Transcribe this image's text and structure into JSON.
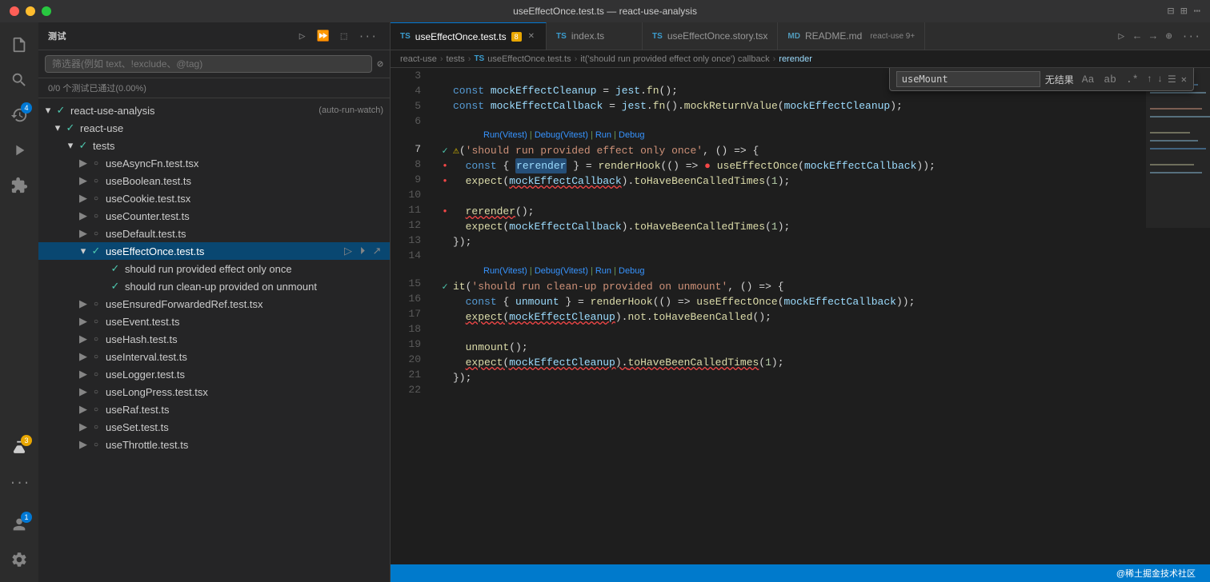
{
  "titleBar": {
    "title": "useEffectOnce.test.ts — react-use-analysis"
  },
  "activityBar": {
    "icons": [
      {
        "name": "files-icon",
        "symbol": "⎘",
        "active": false
      },
      {
        "name": "search-icon",
        "symbol": "🔍",
        "active": false
      },
      {
        "name": "source-control-icon",
        "symbol": "⑂",
        "active": false,
        "badge": "4",
        "badgeColor": "blue"
      },
      {
        "name": "debug-icon",
        "symbol": "▷",
        "active": false
      },
      {
        "name": "extensions-icon",
        "symbol": "⊞",
        "active": false
      },
      {
        "name": "test-icon",
        "symbol": "⚗",
        "active": true
      }
    ],
    "bottomIcons": [
      {
        "name": "problems-icon",
        "symbol": "⚠",
        "badge": "3",
        "badgeColor": "orange"
      },
      {
        "name": "settings-icon",
        "symbol": "⚙"
      },
      {
        "name": "account-icon",
        "symbol": "👤",
        "badge": "1",
        "badgeColor": "blue"
      }
    ]
  },
  "sidebar": {
    "title": "测试",
    "searchPlaceholder": "筛选器(例如 text、!exclude、@tag)",
    "testStatus": "0/0 个测试已通过(0.00%)",
    "headerIcons": [
      "▷",
      "⏩",
      "⬚",
      "···"
    ],
    "tree": [
      {
        "id": "react-use-analysis",
        "label": "react-use-analysis",
        "indent": 0,
        "expanded": true,
        "tag": "(auto-run-watch)",
        "status": "pass",
        "type": "folder"
      },
      {
        "id": "react-use",
        "label": "react-use",
        "indent": 1,
        "expanded": true,
        "status": "pass",
        "type": "folder"
      },
      {
        "id": "tests",
        "label": "tests",
        "indent": 2,
        "expanded": true,
        "status": "pass",
        "type": "folder"
      },
      {
        "id": "useAsyncFn",
        "label": "useAsyncFn.test.tsx",
        "indent": 3,
        "status": "file",
        "type": "file"
      },
      {
        "id": "useBoolean",
        "label": "useBoolean.test.ts",
        "indent": 3,
        "status": "file",
        "type": "file"
      },
      {
        "id": "useCookie",
        "label": "useCookie.test.tsx",
        "indent": 3,
        "status": "file",
        "type": "file"
      },
      {
        "id": "useCounter",
        "label": "useCounter.test.ts",
        "indent": 3,
        "status": "file",
        "type": "file"
      },
      {
        "id": "useDefault",
        "label": "useDefault.test.ts",
        "indent": 3,
        "status": "file",
        "type": "file"
      },
      {
        "id": "useEffectOnce",
        "label": "useEffectOnce.test.ts",
        "indent": 3,
        "status": "active",
        "expanded": true,
        "type": "file-active"
      },
      {
        "id": "test1",
        "label": "should run provided effect only once",
        "indent": 4,
        "status": "pass",
        "type": "test"
      },
      {
        "id": "test2",
        "label": "should run clean-up provided on unmount",
        "indent": 4,
        "status": "pass",
        "type": "test"
      },
      {
        "id": "useEnsuredForwardedRef",
        "label": "useEnsuredForwardedRef.test.tsx",
        "indent": 3,
        "status": "file",
        "type": "file"
      },
      {
        "id": "useEvent",
        "label": "useEvent.test.ts",
        "indent": 3,
        "status": "file",
        "type": "file"
      },
      {
        "id": "useHash",
        "label": "useHash.test.ts",
        "indent": 3,
        "status": "file",
        "type": "file"
      },
      {
        "id": "useInterval",
        "label": "useInterval.test.ts",
        "indent": 3,
        "status": "file",
        "type": "file"
      },
      {
        "id": "useLogger",
        "label": "useLogger.test.ts",
        "indent": 3,
        "status": "file",
        "type": "file"
      },
      {
        "id": "useLongPress",
        "label": "useLongPress.test.tsx",
        "indent": 3,
        "status": "file",
        "type": "file"
      },
      {
        "id": "useRaf",
        "label": "useRaf.test.ts",
        "indent": 3,
        "status": "file",
        "type": "file"
      },
      {
        "id": "useSet",
        "label": "useSet.test.ts",
        "indent": 3,
        "status": "file",
        "type": "file"
      },
      {
        "id": "useThrottle",
        "label": "useThrottle.test.ts",
        "indent": 3,
        "status": "file",
        "type": "file"
      }
    ]
  },
  "tabs": [
    {
      "id": "useEffectOnce-test",
      "label": "useEffectOnce.test.ts",
      "type": "ts",
      "active": true,
      "dirty": true,
      "badge": "8"
    },
    {
      "id": "index",
      "label": "index.ts",
      "type": "ts",
      "active": false
    },
    {
      "id": "useEffectOnce-story",
      "label": "useEffectOnce.story.tsx",
      "type": "ts",
      "active": false
    },
    {
      "id": "readme",
      "label": "README.md",
      "type": "md",
      "active": false,
      "badge": "react-use 9+"
    }
  ],
  "breadcrumb": {
    "items": [
      "react-use",
      "tests",
      "useEffectOnce.test.ts",
      "it('should run provided effect only once') callback",
      "rerender"
    ]
  },
  "searchOverlay": {
    "query": "useMount",
    "result": "无结果",
    "icons": [
      "Aa",
      "ab",
      ".*"
    ]
  },
  "code": {
    "lines": [
      {
        "num": 3,
        "content": "",
        "gutter": ""
      },
      {
        "num": 4,
        "content": "const mockEffectCleanup = jest.fn();",
        "gutter": ""
      },
      {
        "num": 5,
        "content": "const mockEffectCallback = jest.fn().mockReturnValue(mockEffectCleanup);",
        "gutter": ""
      },
      {
        "num": 6,
        "content": "",
        "gutter": ""
      },
      {
        "num": 7,
        "content": "it('should run provided effect only once', () => {",
        "gutter": "pass"
      },
      {
        "num": 8,
        "content": "  const { rerender } = renderHook(() => useEffectOnce(mockEffectCallback));",
        "gutter": "fail"
      },
      {
        "num": 9,
        "content": "  expect(mockEffectCallback).toHaveBeenCalledTimes(1);",
        "gutter": "fail"
      },
      {
        "num": 10,
        "content": "",
        "gutter": ""
      },
      {
        "num": 11,
        "content": "  rerender();",
        "gutter": "fail"
      },
      {
        "num": 12,
        "content": "  expect(mockEffectCallback).toHaveBeenCalledTimes(1);",
        "gutter": ""
      },
      {
        "num": 13,
        "content": "});",
        "gutter": ""
      },
      {
        "num": 14,
        "content": "",
        "gutter": ""
      },
      {
        "num": 15,
        "content": "it('should run clean-up provided on unmount', () => {",
        "gutter": "pass"
      },
      {
        "num": 16,
        "content": "  const { unmount } = renderHook(() => useEffectOnce(mockEffectCallback));",
        "gutter": ""
      },
      {
        "num": 17,
        "content": "  expect(mockEffectCleanup).not.toHaveBeenCalled();",
        "gutter": ""
      },
      {
        "num": 18,
        "content": "",
        "gutter": ""
      },
      {
        "num": 19,
        "content": "  unmount();",
        "gutter": ""
      },
      {
        "num": 20,
        "content": "  expect(mockEffectCleanup).toHaveBeenCalledTimes(1);",
        "gutter": ""
      },
      {
        "num": 21,
        "content": "});",
        "gutter": ""
      },
      {
        "num": 22,
        "content": "",
        "gutter": ""
      }
    ],
    "runDebugLine1": "Run(Vitest) | Debug(Vitest) | Run | Debug",
    "runDebugLine2": "Run(Vitest) | Debug(Vitest) | Run | Debug"
  },
  "statusBar": {
    "right": "@稀土掘金技术社区"
  }
}
